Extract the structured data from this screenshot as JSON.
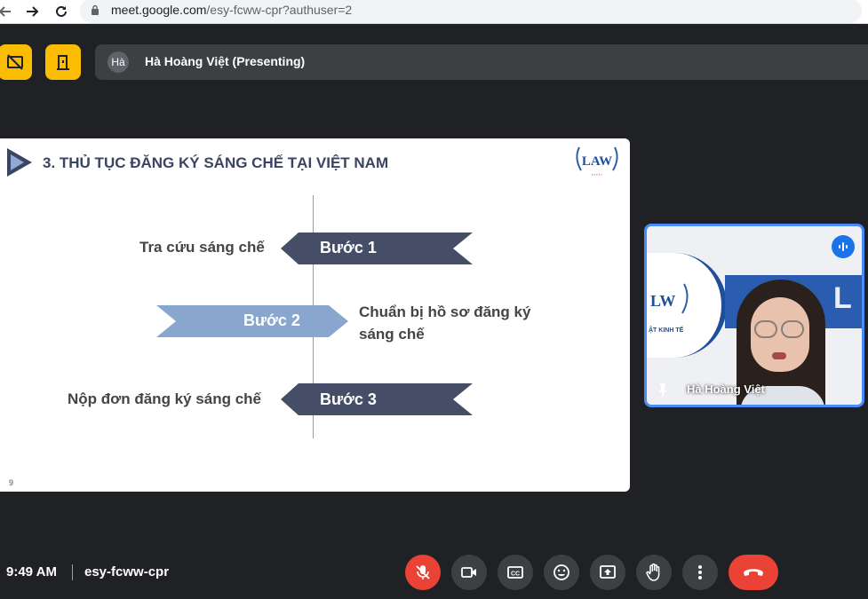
{
  "browser": {
    "url_host": "meet.google.com",
    "url_rest": "/esy-fcww-cpr?authuser=2"
  },
  "presenter": {
    "avatar_text": "Hà",
    "name": "Hà Hoàng Việt (Presenting)"
  },
  "slide": {
    "title": "3. THỦ TỤC ĐĂNG KÝ SÁNG CHẾ TẠI VIỆT NAM",
    "page_number": "9",
    "logo_text": "LAW",
    "steps": [
      {
        "step": "Bước 1",
        "label": "Tra cứu sáng chế"
      },
      {
        "step": "Bước 2",
        "label_line1": "Chuẩn bị hồ sơ đăng ký",
        "label_line2": "sáng chế"
      },
      {
        "step": "Bước 3",
        "label": "Nộp đơn đăng ký sáng chế"
      }
    ],
    "colors": {
      "dark_arrow": "#454e66",
      "light_arrow": "#89a6cf",
      "title": "#3b4461"
    }
  },
  "self_tile": {
    "name": "Hà Hoàng Việt",
    "background_text": "ẬT KINH TẾ"
  },
  "bottom": {
    "time": "9:49 AM",
    "meeting_code": "esy-fcww-cpr"
  },
  "icons": [
    "back-icon",
    "forward-icon",
    "reload-icon",
    "lock-icon",
    "present-off-icon",
    "door-icon",
    "pin-icon",
    "mic-off-icon",
    "camera-icon",
    "captions-icon",
    "emoji-icon",
    "present-icon",
    "hand-icon",
    "more-icon",
    "end-call-icon"
  ]
}
